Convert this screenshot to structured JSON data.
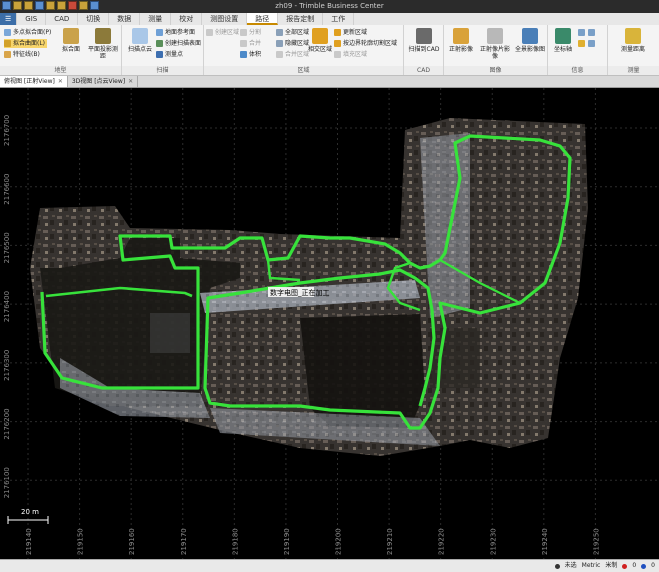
{
  "window": {
    "title": "zh09 - Trimble Business Center"
  },
  "ribbon_tabs": [
    "",
    "GIS",
    "CAD",
    "切换",
    "数据",
    "测量",
    "校对",
    "测图设置",
    "路径",
    "报告定制",
    "工作"
  ],
  "active_tab_index": 8,
  "ribbon": {
    "groups": [
      {
        "label": "地型"
      },
      {
        "label": "扫描"
      },
      {
        "label": "区域"
      },
      {
        "label": "CAD"
      },
      {
        "label": "图像"
      },
      {
        "label": "信息"
      },
      {
        "label": "测量"
      }
    ],
    "buttons": {
      "g1_small1": "多点拟合面(P)",
      "g1_small2": "拟合曲面(L)",
      "g1_small3": "特征线(B)",
      "g1_big1": "拟合面",
      "g1_big2": "平面投影测距",
      "g2_big1": "扫描点云",
      "g2_small1": "地面参考面",
      "g2_small2": "创建扫描表面",
      "g2_small3": "测量点",
      "g3_small1": "创建区域",
      "g3_small2": "分割",
      "g3_small3": "合并",
      "g3_small4": "体积",
      "g3_small5": "全部区域",
      "g3_small6": "隐藏区域",
      "g3_small7": "合并区域",
      "g3_big1": "相交区域",
      "g3_small8": "更新区域",
      "g3_small9": "按边界轮廓切割区域",
      "g3_small10": "填充区域",
      "g4_big1": "扫描到CAD",
      "g5_big1": "正射影像",
      "g5_big2": "正射像片影像",
      "g5_big3": "全景影像图",
      "g6_big1": "坐标轴",
      "g7_big1": "测量距离"
    }
  },
  "view_tabs": [
    {
      "label": "俯视图 [正射View]",
      "active": true
    },
    {
      "label": "3D视图 [点云View]",
      "active": false
    }
  ],
  "viewport": {
    "y_grid_labels": [
      "2176700",
      "2176600",
      "2176500",
      "2176400",
      "2176300",
      "2176200",
      "2176100"
    ],
    "x_grid_labels": [
      "219140",
      "219150",
      "219160",
      "219170",
      "219180",
      "219190",
      "219200",
      "219210",
      "219220",
      "219230",
      "219240",
      "219250"
    ],
    "scale_bar_label": "20 m",
    "point_label": "数字电图_正在加工",
    "boundary_color": "#37e23b"
  },
  "status": {
    "items": [
      "未选",
      "Metric",
      "米制",
      "0",
      "0"
    ]
  }
}
